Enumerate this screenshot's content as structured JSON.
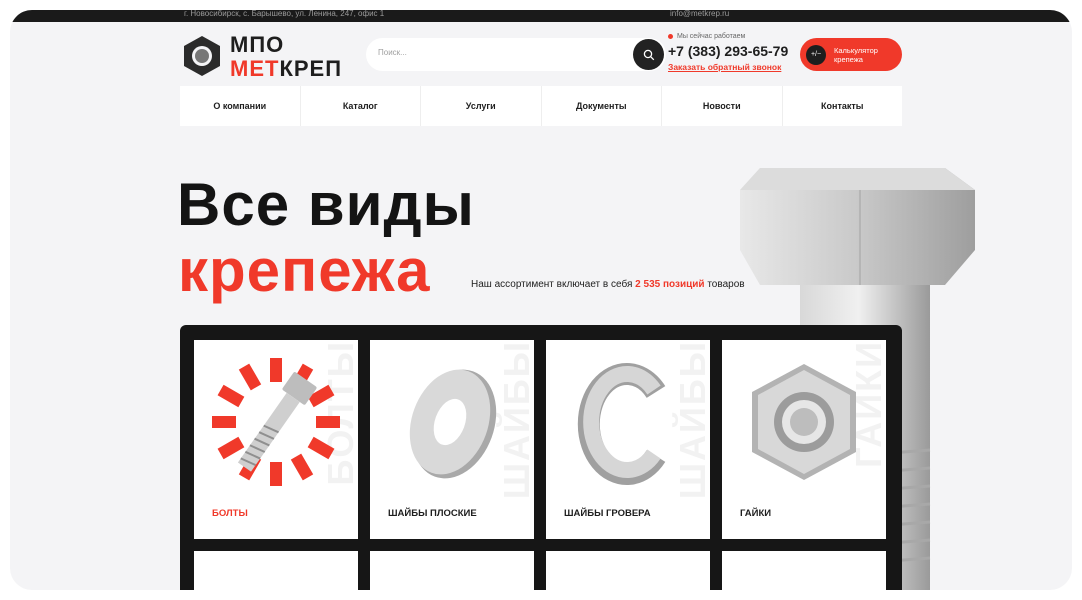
{
  "topbar": {
    "address": "г. Новосибирск, с. Барышево, ул. Ленина, 247, офис 1",
    "email": "info@metkrep.ru"
  },
  "logo": {
    "line1": "МПО",
    "line2_red": "МЕТ",
    "line2_black": "КРЕП"
  },
  "search": {
    "placeholder": "Поиск..."
  },
  "contact": {
    "status": "Мы сейчас работаем",
    "phone": "+7 (383) 293-65-79",
    "callback": "Заказать обратный звонок"
  },
  "calculator": {
    "symbol": "+/−",
    "label": "Калькулятор крепежа"
  },
  "nav": {
    "items": [
      "О компании",
      "Каталог",
      "Услуги",
      "Документы",
      "Новости",
      "Контакты"
    ]
  },
  "hero": {
    "line1": "Все виды",
    "line2": "крепежа",
    "subtitle_before": "Наш ассортимент включает в себя ",
    "subtitle_count": "2 535 позиций",
    "subtitle_after": " товаров"
  },
  "catalog": {
    "cards": [
      {
        "name": "БОЛТЫ",
        "watermark": "БОЛТЫ"
      },
      {
        "name": "ШАЙБЫ ПЛОСКИЕ",
        "watermark": "ШАЙБЫ"
      },
      {
        "name": "ШАЙБЫ ГРОВЕРА",
        "watermark": "ШАЙБЫ"
      },
      {
        "name": "ГАЙКИ",
        "watermark": "ГАЙКИ"
      }
    ]
  },
  "colors": {
    "accent": "#f0392a",
    "dark": "#161616",
    "background": "#f4f4f6"
  }
}
